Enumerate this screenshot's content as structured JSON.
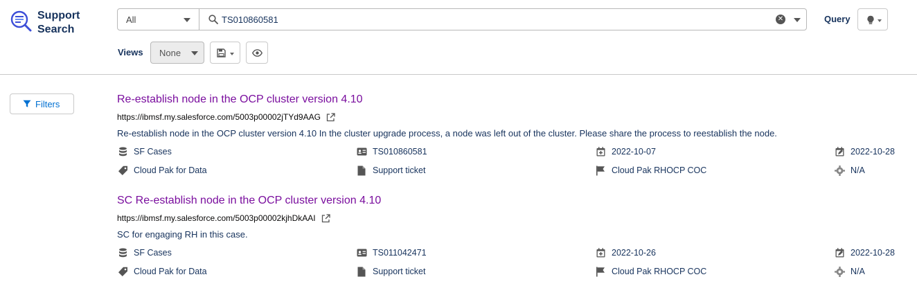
{
  "app": {
    "title_line1": "Support",
    "title_line2": "Search"
  },
  "search": {
    "scope_value": "All",
    "query_value": "TS010860581",
    "query_label": "Query"
  },
  "views": {
    "label": "Views",
    "selected": "None"
  },
  "filters": {
    "label": "Filters"
  },
  "results": [
    {
      "title": "Re-establish node in the OCP cluster version 4.10",
      "url": "https://ibmsf.my.salesforce.com/5003p00002jTYd9AAG",
      "description": "Re-establish node in the OCP cluster version 4.10 In the cluster upgrade process, a node was left out of the cluster. Please share the process to reestablish the node.",
      "source": "SF Cases",
      "case_number": "TS010860581",
      "created": "2022-10-07",
      "modified": "2022-10-28",
      "product": "Cloud Pak for Data",
      "doc_type": "Support ticket",
      "team": "Cloud Pak RHOCP COC",
      "severity": "N/A"
    },
    {
      "title": "SC Re-establish node in the OCP cluster version 4.10",
      "url": "https://ibmsf.my.salesforce.com/5003p00002kjhDkAAI",
      "description": "SC for engaging RH in this case.",
      "source": "SF Cases",
      "case_number": "TS011042471",
      "created": "2022-10-26",
      "modified": "2022-10-28",
      "product": "Cloud Pak for Data",
      "doc_type": "Support ticket",
      "team": "Cloud Pak RHOCP COC",
      "severity": "N/A"
    }
  ],
  "icons": {
    "logo": "search-list-icon",
    "source": "database-icon",
    "case_number": "id-card-icon",
    "created": "calendar-plus-icon",
    "modified": "calendar-edit-icon",
    "product": "tag-icon",
    "doc_type": "document-icon",
    "team": "flag-icon",
    "severity": "gear-icon"
  },
  "colors": {
    "title_link": "#7a0e9e",
    "accent_blue": "#0070d2",
    "logo_blue": "#3d4ed8",
    "text": "#16325c"
  }
}
